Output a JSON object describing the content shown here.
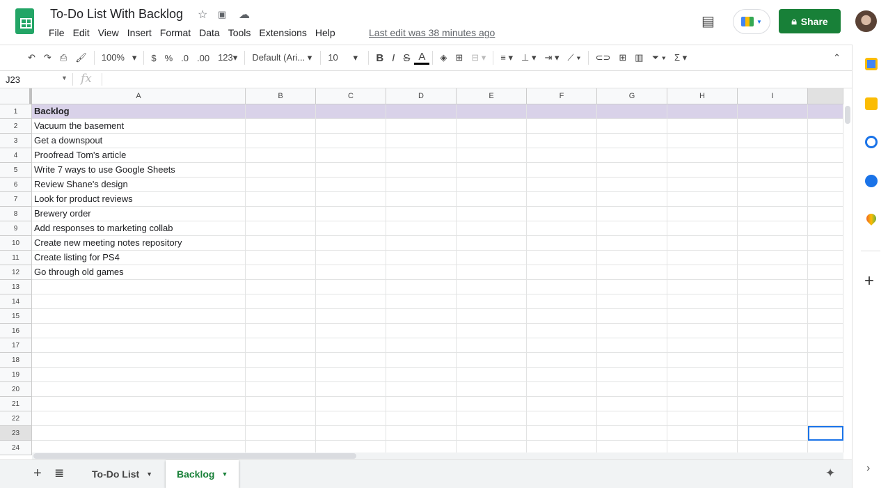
{
  "doc": {
    "title": "To-Do List With Backlog",
    "last_edit": "Last edit was 38 minutes ago"
  },
  "menu": [
    "File",
    "Edit",
    "View",
    "Insert",
    "Format",
    "Data",
    "Tools",
    "Extensions",
    "Help"
  ],
  "header": {
    "share_label": "Share",
    "accent": "#188038"
  },
  "toolbar": {
    "zoom": "100%",
    "currency": "$",
    "percent": "%",
    "dec_less": ".0",
    "dec_more": ".00",
    "more_formats": "123",
    "font": "Default (Ari...",
    "font_size": "10",
    "bold": "B",
    "italic": "I",
    "strike": "S",
    "text_color": "A"
  },
  "formula_bar": {
    "name_box": "J23",
    "fx": "fx",
    "value": ""
  },
  "columns": [
    "A",
    "B",
    "C",
    "D",
    "E",
    "F",
    "G",
    "H",
    "I",
    ""
  ],
  "rows": [
    "1",
    "2",
    "3",
    "4",
    "5",
    "6",
    "7",
    "8",
    "9",
    "10",
    "11",
    "12",
    "13",
    "14",
    "15",
    "16",
    "17",
    "18",
    "19",
    "20",
    "21",
    "22",
    "23",
    "24"
  ],
  "cells_a": [
    "Backlog",
    "Vacuum the basement",
    "Get a downspout",
    "Proofread Tom's article",
    "Write 7 ways to use Google Sheets",
    "Review Shane's design",
    "Look for product reviews",
    "Brewery order",
    "Add responses to marketing collab",
    "Create new meeting notes repository",
    "Create listing for PS4",
    "Go through old games"
  ],
  "header_row_color": "#d9d2e9",
  "selected_cell": "J23",
  "sheets": [
    {
      "label": "To-Do List",
      "active": false
    },
    {
      "label": "Backlog",
      "active": true
    }
  ],
  "side_panel": [
    "calendar-icon",
    "keep-icon",
    "tasks-icon",
    "contacts-icon",
    "maps-icon",
    "add-icon"
  ]
}
